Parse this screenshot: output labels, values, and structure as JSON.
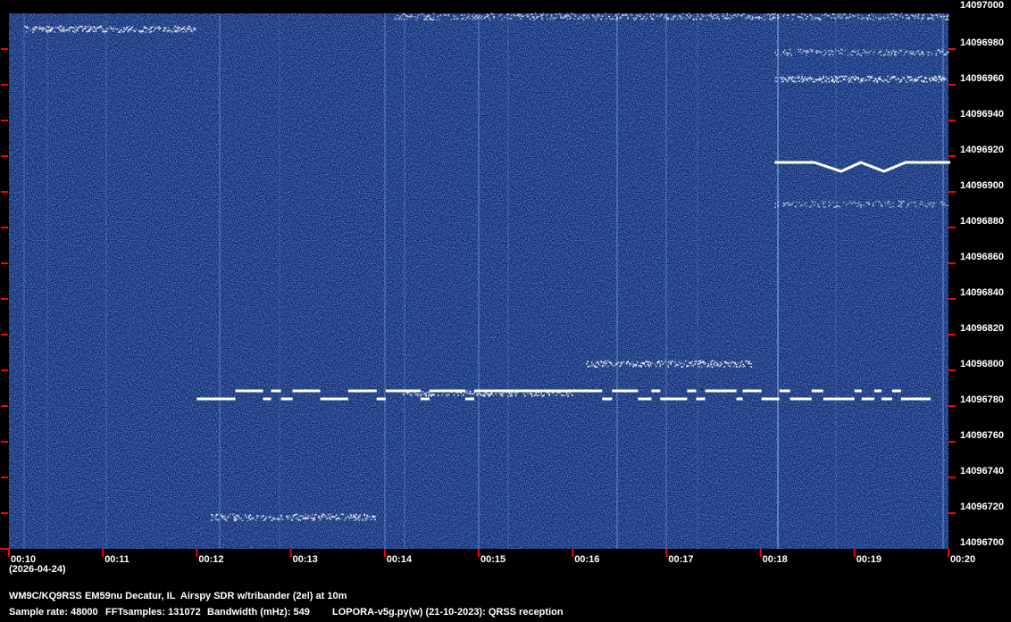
{
  "chart_data": {
    "type": "heatmap",
    "subtype": "spectrogram-waterfall",
    "x_unit": "minutes (UTC clock, mm)",
    "xlim_min": [
      10,
      20
    ],
    "ylim_hz": [
      14096700,
      14097000
    ],
    "x_ticks": [
      "00:10",
      "00:11",
      "00:12",
      "00:13",
      "00:14",
      "00:15",
      "00:16",
      "00:17",
      "00:18",
      "00:19",
      "00:20"
    ],
    "date_label": "(2026-04-24)",
    "y_ticks": [
      "14097000",
      "14096980",
      "14096960",
      "14096940",
      "14096920",
      "14096900",
      "14096880",
      "14096860",
      "14096840",
      "14096820",
      "14096800",
      "14096780",
      "14096760",
      "14096740",
      "14096720",
      "14096700"
    ],
    "bands": [
      {
        "t_start": 10.15,
        "t_end": 12.0,
        "freq_hz": 14096991,
        "intensity": 1.0
      },
      {
        "t_start": 14.1,
        "t_end": 20.0,
        "freq_hz": 14096998,
        "intensity": 0.55
      },
      {
        "t_start": 18.15,
        "t_end": 20.0,
        "freq_hz": 14096963,
        "intensity": 1.0
      },
      {
        "t_start": 18.15,
        "t_end": 20.0,
        "freq_hz": 14096978,
        "intensity": 0.45
      },
      {
        "t_start": 18.15,
        "t_end": 20.0,
        "freq_hz": 14096893,
        "intensity": 0.35
      },
      {
        "t_start": 16.14,
        "t_end": 17.9,
        "freq_hz": 14096803.5,
        "intensity": 0.95
      },
      {
        "t_start": 14.19,
        "t_end": 16.0,
        "freq_hz": 14096787,
        "intensity": 0.9
      },
      {
        "t_start": 12.15,
        "t_end": 13.9,
        "freq_hz": 14096717.5,
        "intensity": 0.9
      }
    ],
    "v_trace": {
      "points": [
        [
          18.15,
          14096916.5
        ],
        [
          18.571,
          14096916.5
        ],
        [
          18.857,
          14096911.5
        ],
        [
          19.067,
          14096916.5
        ],
        [
          19.314,
          14096911.5
        ],
        [
          19.543,
          14096916.5
        ],
        [
          20.019,
          14096916.5
        ]
      ]
    },
    "fsk_trace": {
      "levels_hz": [
        14096784,
        14096788.5
      ],
      "start_level": 0,
      "transitions_min": [
        12.0,
        12.41,
        12.705,
        12.79,
        12.895,
        13.019,
        13.314,
        13.61,
        13.914,
        14.01,
        14.381,
        14.476,
        14.857,
        14.952,
        16.314,
        16.419,
        16.695,
        16.838,
        16.933,
        17.219,
        17.314,
        17.41,
        17.743,
        17.81,
        18.01,
        18.2,
        18.314,
        18.543,
        18.667,
        19.0,
        19.076,
        19.21,
        19.286,
        19.4,
        19.495
      ],
      "end_min": 19.81
    },
    "colors": {
      "background": "#082266",
      "signal": "#ffffff",
      "tick": "#ff0000"
    }
  },
  "footer": {
    "station": "WM9C/KQ9RSS EM59nu Decatur, IL  Airspy SDR w/tribander (2el) at 10m",
    "sample_rate": "Sample rate: 48000",
    "fft_samples": "FFTsamples: 131072",
    "bandwidth": "Bandwidth (mHz): 549",
    "software": "LOPORA-v5g.py(w) (21-10-2023): QRSS reception"
  }
}
